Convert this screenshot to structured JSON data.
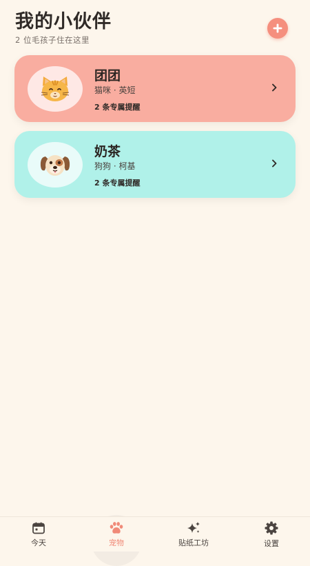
{
  "header": {
    "title": "我的小伙伴",
    "subtitle": "2 位毛孩子住在这里"
  },
  "pets": [
    {
      "name": "团团",
      "breed": "猫咪 · 英短",
      "reminders": "2 条专属提醒",
      "avatar_icon": "cat-face-icon",
      "card_color": "#f9ada0"
    },
    {
      "name": "奶茶",
      "breed": "狗狗 · 柯基",
      "reminders": "2 条专属提醒",
      "avatar_icon": "dog-face-icon",
      "card_color": "#b0f1e9"
    }
  ],
  "tabbar": {
    "tabs": [
      {
        "label": "今天",
        "icon": "calendar-icon",
        "active": false
      },
      {
        "label": "宠物",
        "icon": "paw-icon",
        "active": true
      },
      {
        "label": "贴纸工坊",
        "icon": "sparkle-icon",
        "active": false
      },
      {
        "label": "设置",
        "icon": "gear-icon",
        "active": false
      }
    ]
  },
  "colors": {
    "background": "#fdf6ec",
    "accent": "#f58f7e",
    "active_tab": "#f08a78"
  }
}
